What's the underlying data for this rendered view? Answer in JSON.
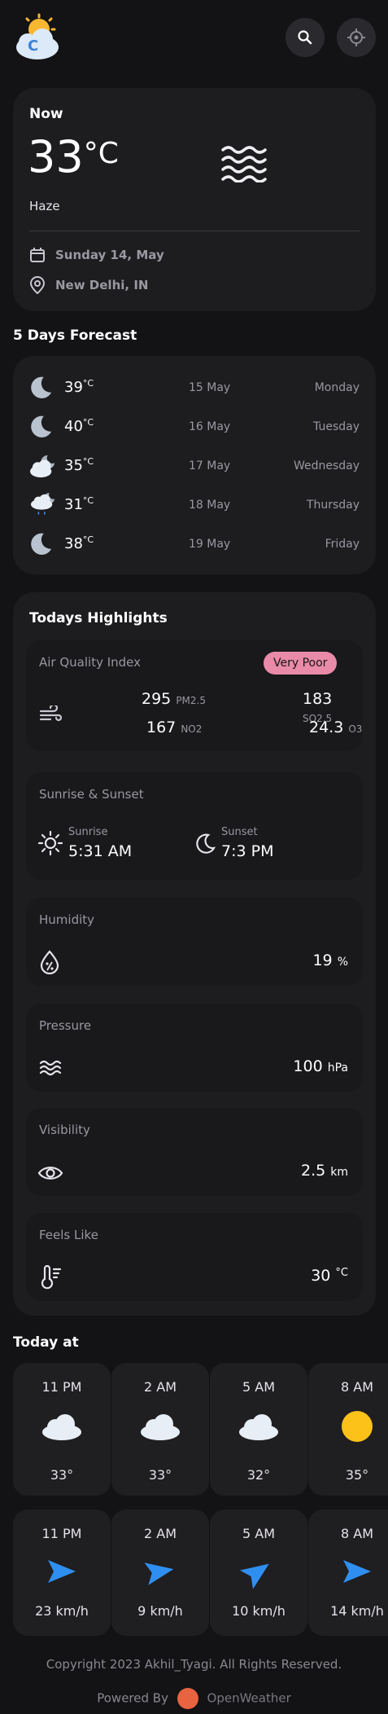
{
  "header": {
    "logo_letter": "C"
  },
  "now": {
    "title": "Now",
    "temp": "33",
    "unit": "°C",
    "condition": "Haze",
    "date": "Sunday 14, May",
    "location": "New Delhi, IN"
  },
  "forecast": {
    "title": "5 Days Forecast",
    "unit": "°C",
    "days": [
      {
        "temp": "39",
        "date": "15 May",
        "weekday": "Monday",
        "icon": "moon-icon"
      },
      {
        "temp": "40",
        "date": "16 May",
        "weekday": "Tuesday",
        "icon": "moon-icon"
      },
      {
        "temp": "35",
        "date": "17 May",
        "weekday": "Wednesday",
        "icon": "cloud-moon-icon"
      },
      {
        "temp": "31",
        "date": "18 May",
        "weekday": "Thursday",
        "icon": "rain-cloud-icon"
      },
      {
        "temp": "38",
        "date": "19 May",
        "weekday": "Friday",
        "icon": "moon-icon"
      }
    ]
  },
  "highlights": {
    "title": "Todays Highlights",
    "aqi": {
      "title": "Air Quality Index",
      "badge": "Very Poor",
      "badge_color": "#e98ba8",
      "pm25": "295",
      "pm25_label": "PM2.5",
      "so2": "183",
      "so2_label": "SO2.5",
      "no2": "167",
      "no2_label": "NO2",
      "o3": "24.3",
      "o3_label": "O3"
    },
    "sun": {
      "title": "Sunrise & Sunset",
      "sunrise_label": "Sunrise",
      "sunrise": "5:31 AM",
      "sunset_label": "Sunset",
      "sunset": "7:3 PM"
    },
    "humidity": {
      "title": "Humidity",
      "value": "19",
      "unit": "%"
    },
    "pressure": {
      "title": "Pressure",
      "value": "100",
      "unit": "hPa"
    },
    "visibility": {
      "title": "Visibility",
      "value": "2.5",
      "unit": "km"
    },
    "feels": {
      "title": "Feels Like",
      "value": "30",
      "unit": "°C"
    }
  },
  "today": {
    "title": "Today at",
    "hours": [
      {
        "time": "11 PM",
        "temp": "33°",
        "icon": "cloud-icon"
      },
      {
        "time": "2 AM",
        "temp": "33°",
        "icon": "cloud-icon"
      },
      {
        "time": "5 AM",
        "temp": "32°",
        "icon": "cloud-icon"
      },
      {
        "time": "8 AM",
        "temp": "35°",
        "icon": "sun-icon"
      }
    ],
    "wind": [
      {
        "time": "11 PM",
        "speed": "23 km/h"
      },
      {
        "time": "2 AM",
        "speed": "9 km/h"
      },
      {
        "time": "5 AM",
        "speed": "10 km/h"
      },
      {
        "time": "8 AM",
        "speed": "14 km/h"
      }
    ]
  },
  "footer": {
    "copyright": "Copyright 2023 Akhil_Tyagi. All Rights Reserved.",
    "powered": "Powered By",
    "brand": "OpenWeather",
    "brand_color": "#e8633f"
  },
  "colors": {
    "background": "#131214",
    "card": "#1d1c1f",
    "accent_blue": "#2f8ff0",
    "sun_yellow": "#fcc21a"
  }
}
